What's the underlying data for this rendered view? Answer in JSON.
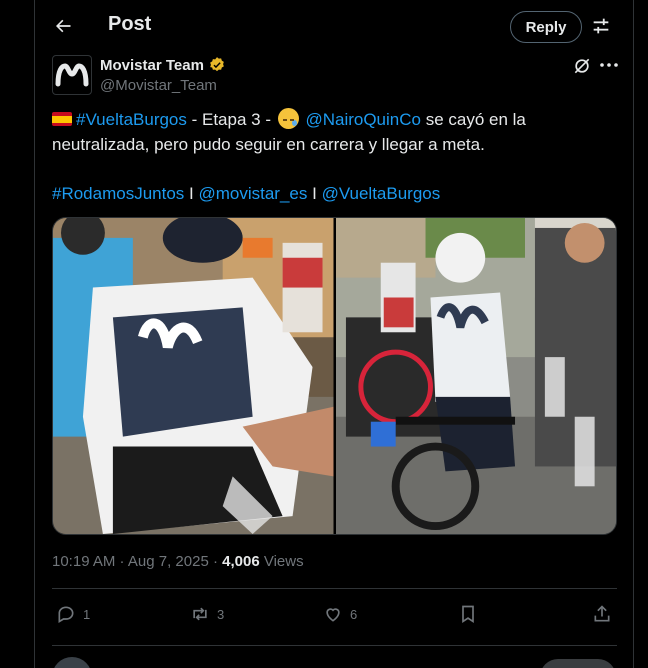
{
  "header": {
    "title": "Post",
    "reply_label": "Reply"
  },
  "author": {
    "name": "Movistar Team",
    "handle": "@Movistar_Team"
  },
  "tweet": {
    "seg1": "#VueltaBurgos",
    "seg2": " - Etapa 3 - ",
    "seg3": "@NairoQuinCo",
    "seg4": " se cayó en la neutralizada, pero pudo seguir en carrera y llegar a meta.",
    "tag1": "#RodamosJuntos",
    "sep1": " I ",
    "tag2": "@movistar_es",
    "sep2": " I ",
    "tag3": "@VueltaBurgos"
  },
  "meta": {
    "time_date": "10:19 AM · Aug 7, 2025 · ",
    "views_count": "4,006",
    "views_label": " Views"
  },
  "actions": {
    "replies": "1",
    "reposts": "3",
    "likes": "6"
  },
  "colors": {
    "link": "#1d9bf0",
    "muted": "#71767b",
    "text": "#e7e9ea",
    "border": "#2f3336"
  }
}
